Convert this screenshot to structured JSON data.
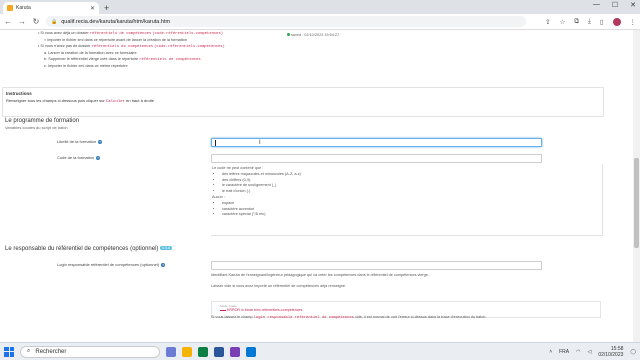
{
  "browser": {
    "tab_title": "Karuta",
    "url": "qualif.recia.dev/karuta/karuta/htm/karuta.htm",
    "new_tab": "+",
    "win_min": "—",
    "win_max": "☐",
    "win_close": "✕",
    "back": "←",
    "forward": "→",
    "reload": "↻",
    "lock": "🔒"
  },
  "top_info": {
    "line1_pre": "Si vous avez déjà un dossier ",
    "line1_code": "référentiels de compétences",
    "line1_code2": "(code-référentiels-competences)",
    "line2": "importer le fichier xml dans ce répertoire avant de lancer la création de la formation",
    "line3_pre": "Si vous n'avez pas de dossier ",
    "line3_code": "référentiels de compétences",
    "line3_code2": "(code-référentiels-competences)",
    "step1": "a. Lancer la création de la formation avec ce formulaire",
    "step2_pre": "b. Supprimer le référentiel vierge créé dans le répertoire ",
    "step2_code": "référentiels de compétences",
    "step3": "c. Importer le fichier xml dans ce même répertoire",
    "saved": "saved : 02/10/2023 15:54:27"
  },
  "instructions": {
    "title": "Instructions",
    "text_pre": "Renseigner tous les champs ci-dessous puis cliquer sur ",
    "text_code": "Calculer",
    "text_post": " en haut à droite"
  },
  "programme": {
    "title": "Le programme de formation",
    "subtitle": "Variables locales du script de batch",
    "libelle_label": "Libellé de la formation",
    "libelle_value": "",
    "code_label": "Code de la formation",
    "code_value": "",
    "help_intro": "Le code ne peut contenir que :",
    "help_allowed": [
      "des lettres majuscules et minuscules (A-Z, a-z)",
      "des chiffres (0-9)",
      "le caractère de soulignement (_)",
      "le trait d'union (-)"
    ],
    "help_none": "Aucun :",
    "help_forbidden": [
      "espace",
      "caractère accentué",
      "caractère spécial (°/& etc)"
    ]
  },
  "responsable": {
    "title": "Le responsable du référentiel de compétences (optionnel)",
    "badge": "0.5.6",
    "login_label": "Login responsable référentiel de compétences (optionnel)",
    "login_value": "",
    "help1": "Identifiant Karuta de l'enseignant/ingénieur pédagogique qui va créer les compétences dans le référentiel de compétences vierge.",
    "help2": "Laisser vide si vous avez importé un référentiel de compétences déjà renseigné.",
    "err_legend": "Sortie Créée",
    "err_line": "ERROR in block bloc-referentiels-competences",
    "note_pre": "Si vous laissez le champ ",
    "note_code": "login responsable référentiel de compétences",
    "note_post": " vide, il est normal de voir l'erreur ci-dessus dans la trace d'exécution du batch."
  },
  "taskbar": {
    "search_placeholder": "Rechercher",
    "lang": "FRA",
    "time": "15:58",
    "date": "02/10/2023"
  }
}
